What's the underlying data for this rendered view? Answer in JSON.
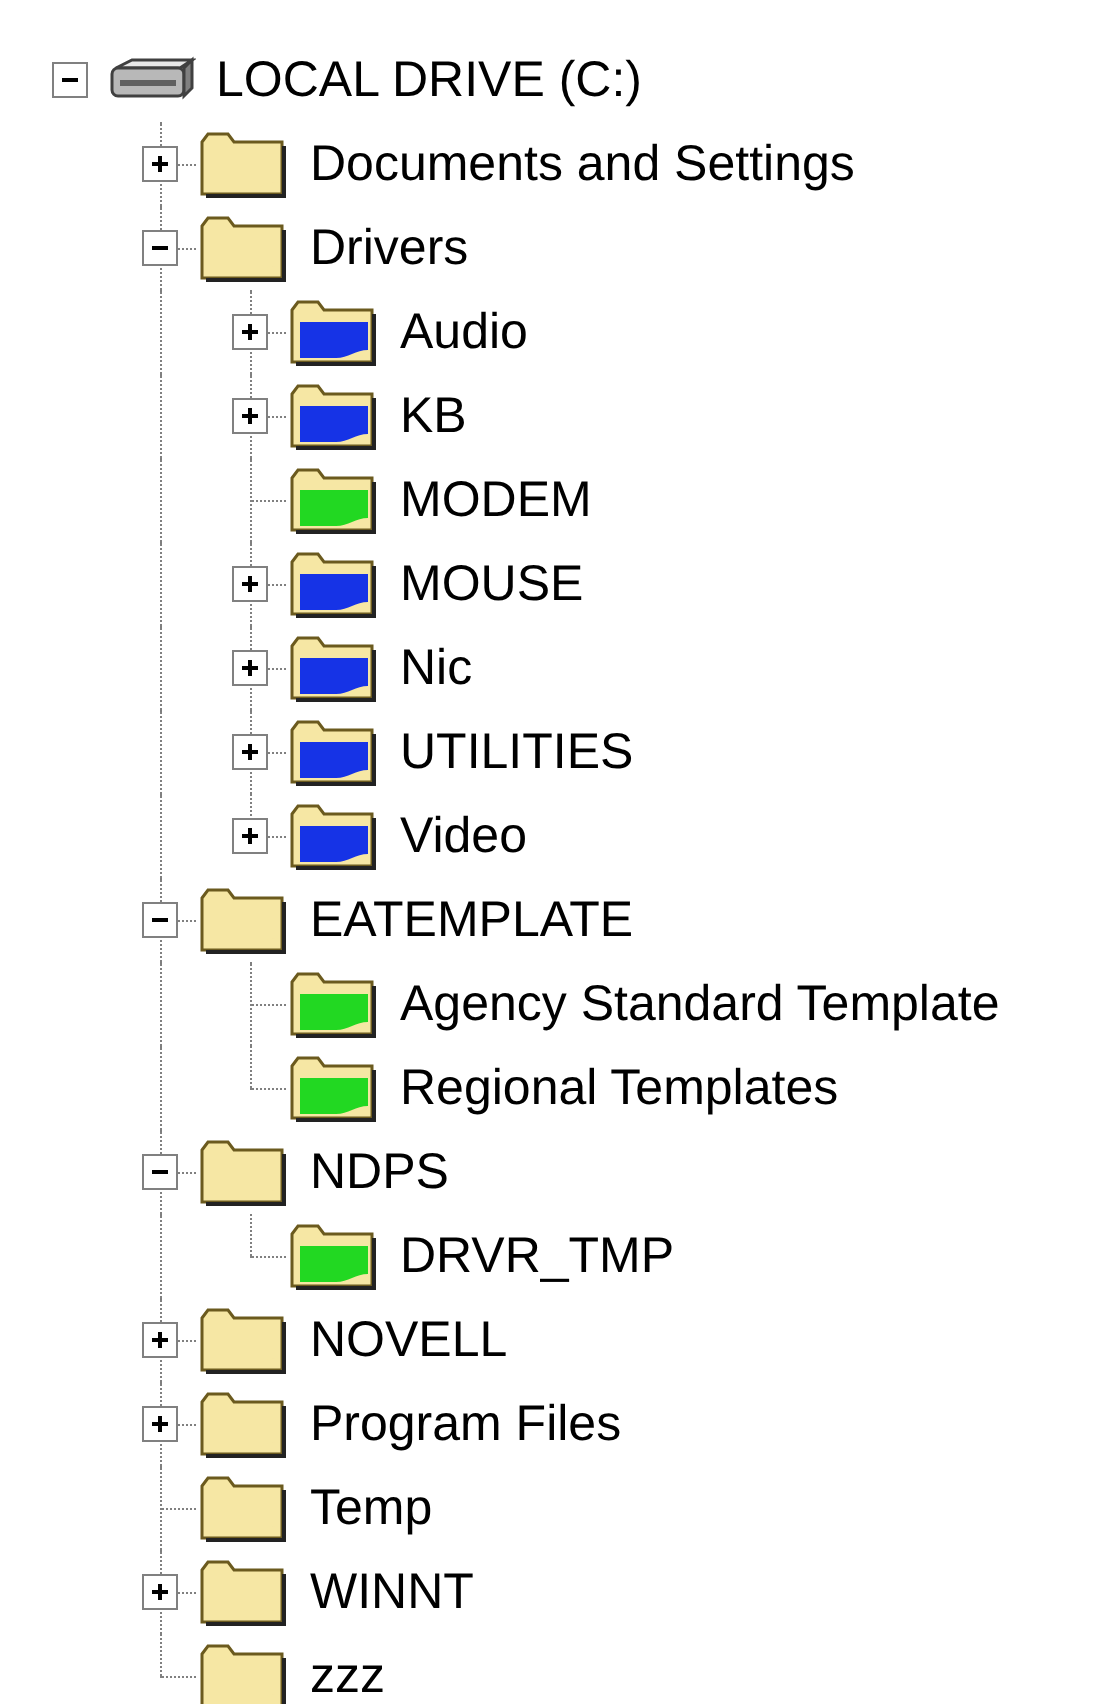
{
  "tree": [
    {
      "label": "LOCAL DRIVE (C:)",
      "kind": "drive",
      "expanded": true,
      "children": [
        {
          "label": "Documents and Settings",
          "kind": "folder",
          "color": "#f6e7a4",
          "expanded": false
        },
        {
          "label": "Drivers",
          "kind": "folder",
          "color": "#f6e7a4",
          "expanded": true,
          "children": [
            {
              "label": "Audio",
              "kind": "folder",
              "color": "#1633e6",
              "expanded": false
            },
            {
              "label": "KB",
              "kind": "folder",
              "color": "#1633e6",
              "expanded": false
            },
            {
              "label": "MODEM",
              "kind": "folder",
              "color": "#22d822"
            },
            {
              "label": "MOUSE",
              "kind": "folder",
              "color": "#1633e6",
              "expanded": false
            },
            {
              "label": "Nic",
              "kind": "folder",
              "color": "#1633e6",
              "expanded": false
            },
            {
              "label": "UTILITIES",
              "kind": "folder",
              "color": "#1633e6",
              "expanded": false
            },
            {
              "label": "Video",
              "kind": "folder",
              "color": "#1633e6",
              "expanded": false
            }
          ]
        },
        {
          "label": "EATEMPLATE",
          "kind": "folder",
          "color": "#f6e7a4",
          "expanded": true,
          "children": [
            {
              "label": "Agency Standard Template",
              "kind": "folder",
              "color": "#22d822"
            },
            {
              "label": "Regional Templates",
              "kind": "folder",
              "color": "#22d822"
            }
          ]
        },
        {
          "label": "NDPS",
          "kind": "folder",
          "color": "#f6e7a4",
          "expanded": true,
          "children": [
            {
              "label": "DRVR_TMP",
              "kind": "folder",
              "color": "#22d822"
            }
          ]
        },
        {
          "label": "NOVELL",
          "kind": "folder",
          "color": "#f6e7a4",
          "expanded": false
        },
        {
          "label": "Program Files",
          "kind": "folder",
          "color": "#f6e7a4",
          "expanded": false
        },
        {
          "label": "Temp",
          "kind": "folder",
          "color": "#f6e7a4"
        },
        {
          "label": "WINNT",
          "kind": "folder",
          "color": "#f6e7a4",
          "expanded": false
        },
        {
          "label": "zzz",
          "kind": "folder",
          "color": "#f6e7a4"
        }
      ]
    }
  ]
}
